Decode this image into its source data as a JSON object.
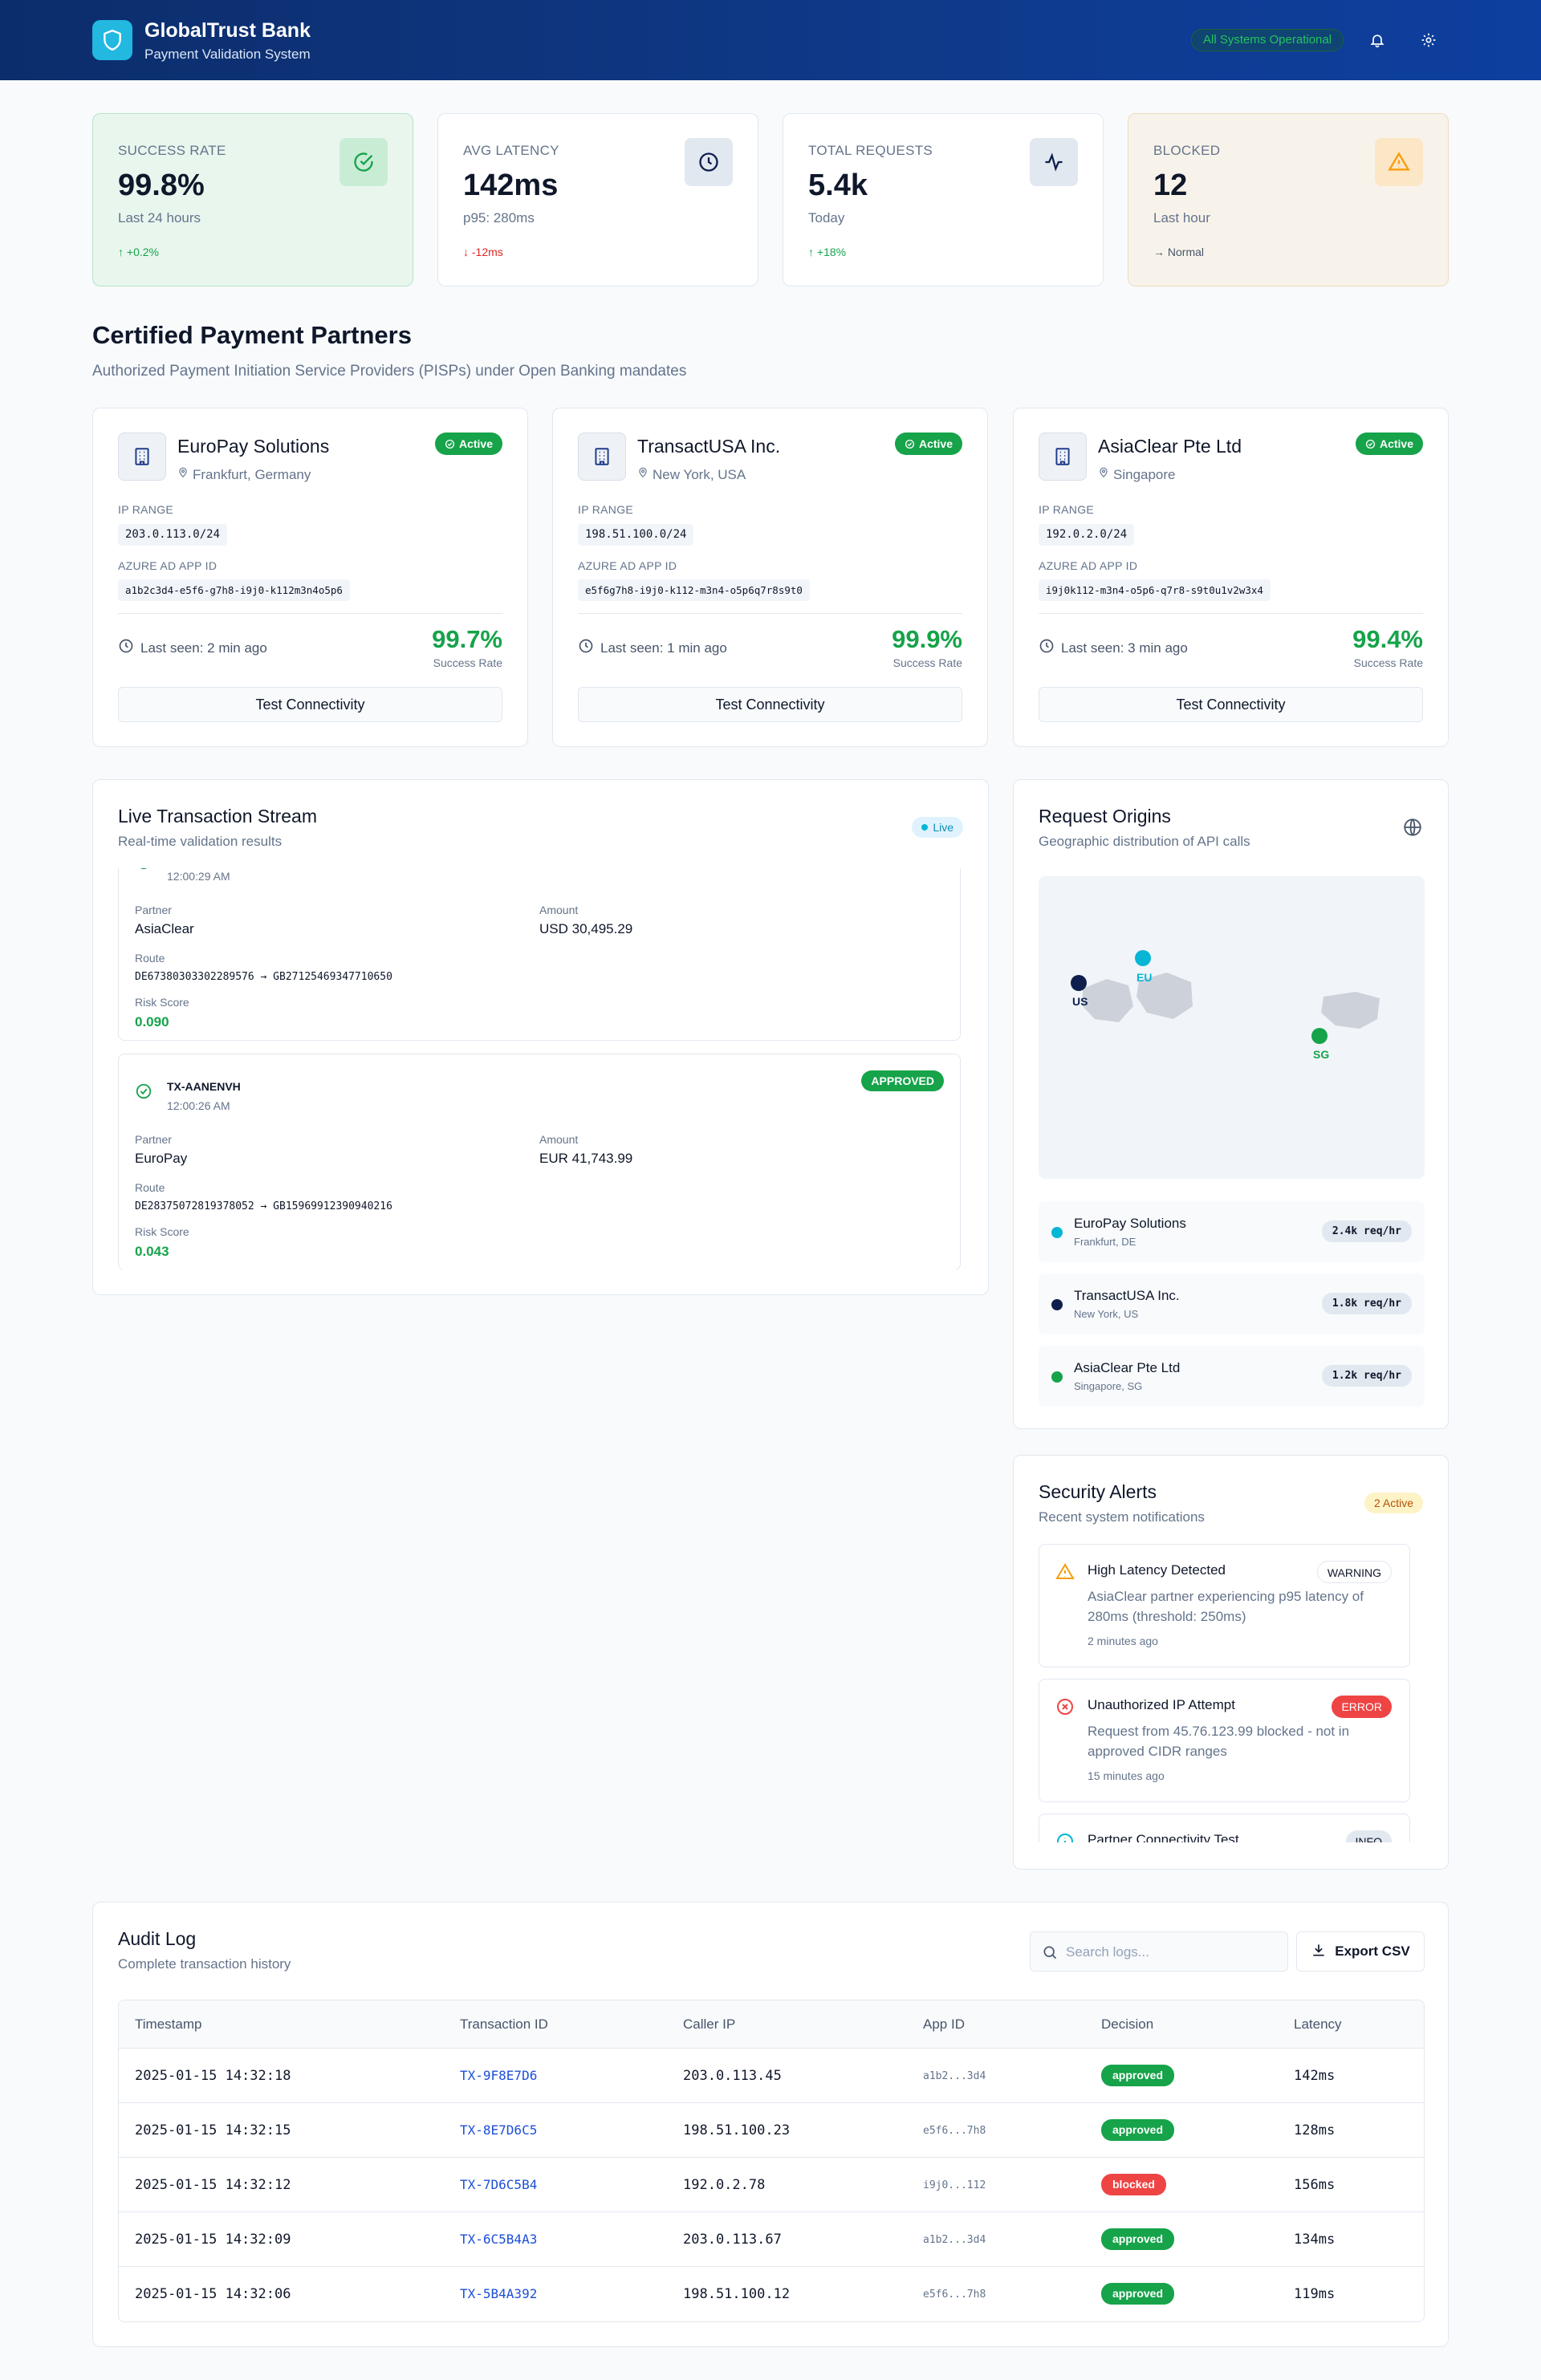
{
  "header": {
    "title": "GlobalTrust Bank",
    "subtitle": "Payment Validation System",
    "status": "All Systems Operational"
  },
  "stats": [
    {
      "label": "SUCCESS RATE",
      "value": "99.8%",
      "sub": "Last 24 hours",
      "change": "↑ +0.2%",
      "icon": "check-circle-icon",
      "color": "#16a34a"
    },
    {
      "label": "AVG LATENCY",
      "value": "142ms",
      "sub": "p95: 280ms",
      "change": "↓ -12ms",
      "icon": "clock-icon",
      "color": "#dc2626"
    },
    {
      "label": "TOTAL REQUESTS",
      "value": "5.4k",
      "sub": "Today",
      "change": "↑ +18%",
      "icon": "activity-icon",
      "color": "#16a34a"
    },
    {
      "label": "BLOCKED",
      "value": "12",
      "sub": "Last hour",
      "change": "→ Normal",
      "icon": "warning-icon",
      "color": "#475569"
    }
  ],
  "partners_section": {
    "title": "Certified Payment Partners",
    "subtitle": "Authorized Payment Initiation Service Providers (PISPs) under Open Banking mandates"
  },
  "partners": [
    {
      "name": "EuroPay Solutions",
      "location": "Frankfurt, Germany",
      "status": "Active",
      "ip_label": "IP RANGE",
      "ip": "203.0.113.0/24",
      "app_label": "AZURE AD APP ID",
      "app_id": "a1b2c3d4-e5f6-g7h8-i9j0-k112m3n4o5p6",
      "last_seen": "Last seen: 2 min ago",
      "rate": "99.7%",
      "rate_label": "Success Rate",
      "button": "Test Connectivity"
    },
    {
      "name": "TransactUSA Inc.",
      "location": "New York, USA",
      "status": "Active",
      "ip_label": "IP RANGE",
      "ip": "198.51.100.0/24",
      "app_label": "AZURE AD APP ID",
      "app_id": "e5f6g7h8-i9j0-k112-m3n4-o5p6q7r8s9t0",
      "last_seen": "Last seen: 1 min ago",
      "rate": "99.9%",
      "rate_label": "Success Rate",
      "button": "Test Connectivity"
    },
    {
      "name": "AsiaClear Pte Ltd",
      "location": "Singapore",
      "status": "Active",
      "ip_label": "IP RANGE",
      "ip": "192.0.2.0/24",
      "app_label": "AZURE AD APP ID",
      "app_id": "i9j0k112-m3n4-o5p6-q7r8-s9t0u1v2w3x4",
      "last_seen": "Last seen: 3 min ago",
      "rate": "99.4%",
      "rate_label": "Success Rate",
      "button": "Test Connectivity"
    }
  ],
  "stream": {
    "title": "Live Transaction Stream",
    "subtitle": "Real-time validation results",
    "badge": "Live",
    "labels": {
      "partner": "Partner",
      "amount": "Amount",
      "route": "Route",
      "risk": "Risk Score"
    },
    "items": [
      {
        "id": "",
        "time": "12:00:29 AM",
        "partner": "AsiaClear",
        "amount": "USD 30,495.29",
        "route": "DE67380303302289576 → GB27125469347710650",
        "risk": "0.090"
      },
      {
        "id": "TX-AANENVH",
        "time": "12:00:26 AM",
        "status": "APPROVED",
        "partner": "EuroPay",
        "amount": "EUR 41,743.99",
        "route": "DE28375072819378052 → GB15969912390940216",
        "risk": "0.043"
      }
    ]
  },
  "origins": {
    "title": "Request Origins",
    "subtitle": "Geographic distribution of API calls",
    "markers": [
      {
        "label": "US",
        "color": "#0f1f4d"
      },
      {
        "label": "EU",
        "color": "#06b6d4"
      },
      {
        "label": "SG",
        "color": "#16a34a"
      }
    ],
    "items": [
      {
        "name": "EuroPay Solutions",
        "loc": "Frankfurt, DE",
        "rate": "2.4k req/hr",
        "color": "#06b6d4"
      },
      {
        "name": "TransactUSA Inc.",
        "loc": "New York, US",
        "rate": "1.8k req/hr",
        "color": "#0f1f4d"
      },
      {
        "name": "AsiaClear Pte Ltd",
        "loc": "Singapore, SG",
        "rate": "1.2k req/hr",
        "color": "#16a34a"
      }
    ]
  },
  "alerts": {
    "title": "Security Alerts",
    "subtitle": "Recent system notifications",
    "count": "2 Active",
    "items": [
      {
        "title": "High Latency Detected",
        "level": "WARNING",
        "body": "AsiaClear partner experiencing p95 latency of 280ms (threshold: 250ms)",
        "ago": "2 minutes ago"
      },
      {
        "title": "Unauthorized IP Attempt",
        "level": "ERROR",
        "body": "Request from 45.76.123.99 blocked - not in approved CIDR ranges",
        "ago": "15 minutes ago"
      },
      {
        "title": "Partner Connectivity Test",
        "level": "INFO",
        "body": "",
        "ago": ""
      }
    ]
  },
  "audit": {
    "title": "Audit Log",
    "subtitle": "Complete transaction history",
    "search_placeholder": "Search logs...",
    "export": "Export CSV",
    "columns": [
      "Timestamp",
      "Transaction ID",
      "Caller IP",
      "App ID",
      "Decision",
      "Latency"
    ],
    "rows": [
      {
        "ts": "2025-01-15 14:32:18",
        "id": "TX-9F8E7D6",
        "ip": "203.0.113.45",
        "app": "a1b2...3d4",
        "decision": "approved",
        "latency": "142ms"
      },
      {
        "ts": "2025-01-15 14:32:15",
        "id": "TX-8E7D6C5",
        "ip": "198.51.100.23",
        "app": "e5f6...7h8",
        "decision": "approved",
        "latency": "128ms"
      },
      {
        "ts": "2025-01-15 14:32:12",
        "id": "TX-7D6C5B4",
        "ip": "192.0.2.78",
        "app": "i9j0...112",
        "decision": "blocked",
        "latency": "156ms"
      },
      {
        "ts": "2025-01-15 14:32:09",
        "id": "TX-6C5B4A3",
        "ip": "203.0.113.67",
        "app": "a1b2...3d4",
        "decision": "approved",
        "latency": "134ms"
      },
      {
        "ts": "2025-01-15 14:32:06",
        "id": "TX-5B4A392",
        "ip": "198.51.100.12",
        "app": "e5f6...7h8",
        "decision": "approved",
        "latency": "119ms"
      }
    ]
  },
  "colors": {
    "approved": "#16a34a",
    "blocked": "#ef4444",
    "accent": "#06b6d4"
  }
}
